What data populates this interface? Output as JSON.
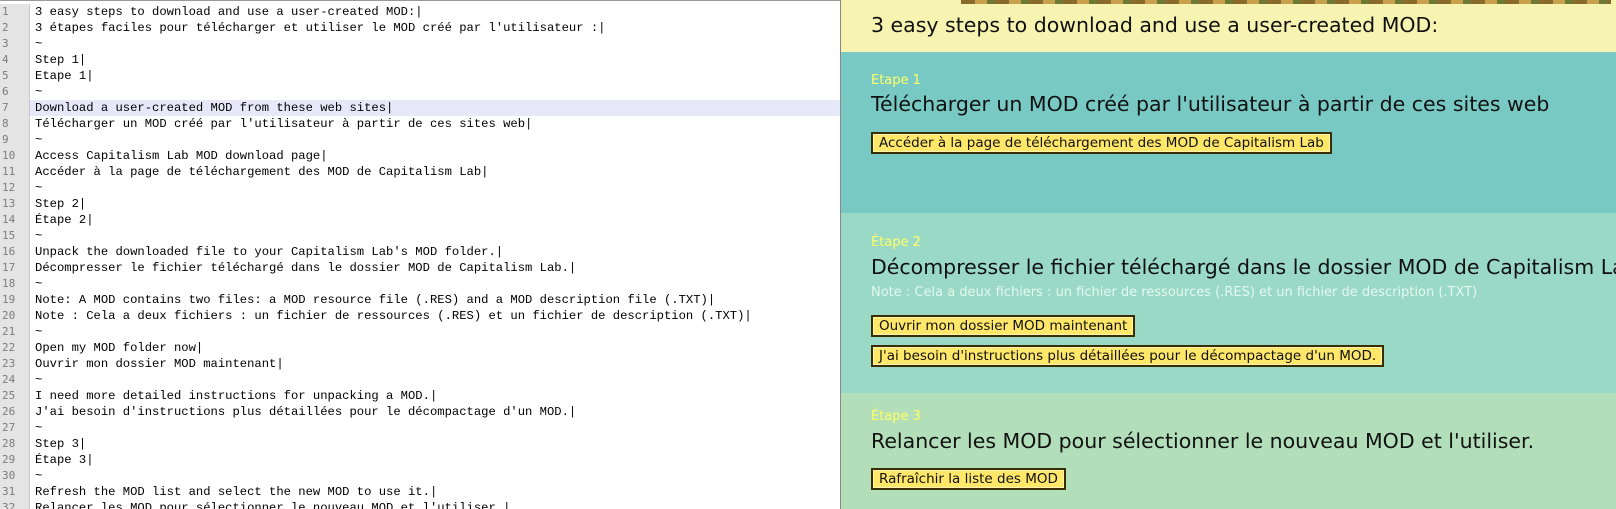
{
  "editor": {
    "lines": [
      {
        "num": "1",
        "text": "3 easy steps to download and use a user-created MOD:|"
      },
      {
        "num": "2",
        "text": "3 étapes faciles pour télécharger et utiliser le MOD créé par l'utilisateur :|"
      },
      {
        "num": "3",
        "text": "~"
      },
      {
        "num": "4",
        "text": "Step 1|"
      },
      {
        "num": "5",
        "text": "Etape 1|"
      },
      {
        "num": "6",
        "text": "~"
      },
      {
        "num": "7",
        "text": "Download a user-created MOD from these web sites|"
      },
      {
        "num": "8",
        "text": "Télécharger un MOD créé par l'utilisateur à partir de ces sites web|"
      },
      {
        "num": "9",
        "text": "~"
      },
      {
        "num": "10",
        "text": "Access Capitalism Lab MOD download page|"
      },
      {
        "num": "11",
        "text": "Accéder à la page de téléchargement des MOD de Capitalism Lab|"
      },
      {
        "num": "12",
        "text": "~"
      },
      {
        "num": "13",
        "text": "Step 2|"
      },
      {
        "num": "14",
        "text": "Étape 2|"
      },
      {
        "num": "15",
        "text": "~"
      },
      {
        "num": "16",
        "text": "Unpack the downloaded file to your Capitalism Lab's MOD folder.|"
      },
      {
        "num": "17",
        "text": "Décompresser le fichier téléchargé dans le dossier MOD de Capitalism Lab.|"
      },
      {
        "num": "18",
        "text": "~"
      },
      {
        "num": "19",
        "text": "Note: A MOD contains two files: a MOD resource file (.RES) and a MOD description file (.TXT)|"
      },
      {
        "num": "20",
        "text": "Note : Cela a deux fichiers : un fichier de ressources (.RES) et un fichier de description (.TXT)|"
      },
      {
        "num": "21",
        "text": "~"
      },
      {
        "num": "22",
        "text": "Open my MOD folder now|"
      },
      {
        "num": "23",
        "text": "Ouvrir mon dossier MOD maintenant|"
      },
      {
        "num": "24",
        "text": "~"
      },
      {
        "num": "25",
        "text": "I need more detailed instructions for unpacking a MOD.|"
      },
      {
        "num": "26",
        "text": "J'ai besoin d'instructions plus détaillées pour le décompactage d'un MOD.|"
      },
      {
        "num": "27",
        "text": "~"
      },
      {
        "num": "28",
        "text": "Step 3|"
      },
      {
        "num": "29",
        "text": "Étape 3|"
      },
      {
        "num": "30",
        "text": "~"
      },
      {
        "num": "31",
        "text": "Refresh the MOD list and select the new MOD to use it.|"
      },
      {
        "num": "32",
        "text": "Relancer les MOD pour sélectionner le nouveau MOD et l'utiliser.|"
      }
    ]
  },
  "preview": {
    "title": "3 easy steps to download and use a user-created MOD:",
    "step1": {
      "label": "Etape 1",
      "heading": "Télécharger un MOD créé par l'utilisateur à partir de ces sites web",
      "button": "Accéder à la page de téléchargement des MOD de Capitalism Lab"
    },
    "step2": {
      "label": "Étape 2",
      "heading": "Décompresser le fichier téléchargé dans le dossier MOD de Capitalism Lab.",
      "note": "Note : Cela a deux fichiers : un fichier de ressources (.RES) et un fichier de description (.TXT)",
      "button_open": "Ouvrir mon dossier MOD maintenant",
      "button_help": "J'ai besoin d'instructions plus détaillées pour le décompactage d'un MOD."
    },
    "step3": {
      "label": "Étape 3",
      "heading": "Relancer les MOD pour sélectionner le nouveau MOD et l'utiliser.",
      "button": "Rafraîchir la liste des MOD"
    }
  }
}
